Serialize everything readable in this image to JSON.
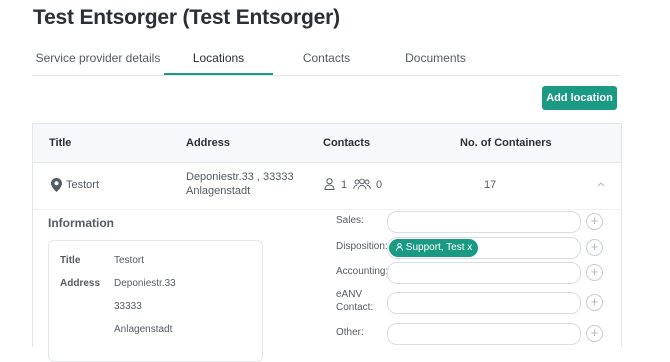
{
  "page": {
    "title": "Test Entsorger (Test Entsorger)"
  },
  "tabs": [
    {
      "label": "Service provider details"
    },
    {
      "label": "Locations"
    },
    {
      "label": "Contacts"
    },
    {
      "label": "Documents"
    }
  ],
  "toolbar": {
    "add_location_label": "Add location"
  },
  "table": {
    "headers": {
      "title": "Title",
      "address": "Address",
      "contacts": "Contacts",
      "containers": "No. of Containers"
    },
    "rows": [
      {
        "title": "Testort",
        "address_line1": "Deponiestr.33 , 33333",
        "address_line2": "Anlagenstadt",
        "contacts_person": "1",
        "contacts_group": "0",
        "containers": "17"
      }
    ]
  },
  "detail": {
    "info_title": "Information",
    "card": {
      "title_key": "Title",
      "title_value": "Testort",
      "address_key": "Address",
      "address_street": "Deponiestr.33",
      "address_zip": "33333",
      "address_city": "Anlagenstadt"
    },
    "fields": {
      "sales_label": "Sales:",
      "disposition_label": "Disposition:",
      "disposition_chip": "Support, Test x",
      "accounting_label": "Accounting:",
      "eanv_label_line1": "eANV",
      "eanv_label_line2": "Contact:",
      "other_label": "Other:"
    }
  },
  "colors": {
    "accent": "#1b9a83",
    "text": "#2b2f36",
    "muted": "#555b63",
    "border": "#e4e7ea"
  },
  "icons": [
    "location-pin-icon",
    "person-icon",
    "group-icon",
    "chevron-up-icon",
    "plus-icon",
    "user-icon"
  ]
}
